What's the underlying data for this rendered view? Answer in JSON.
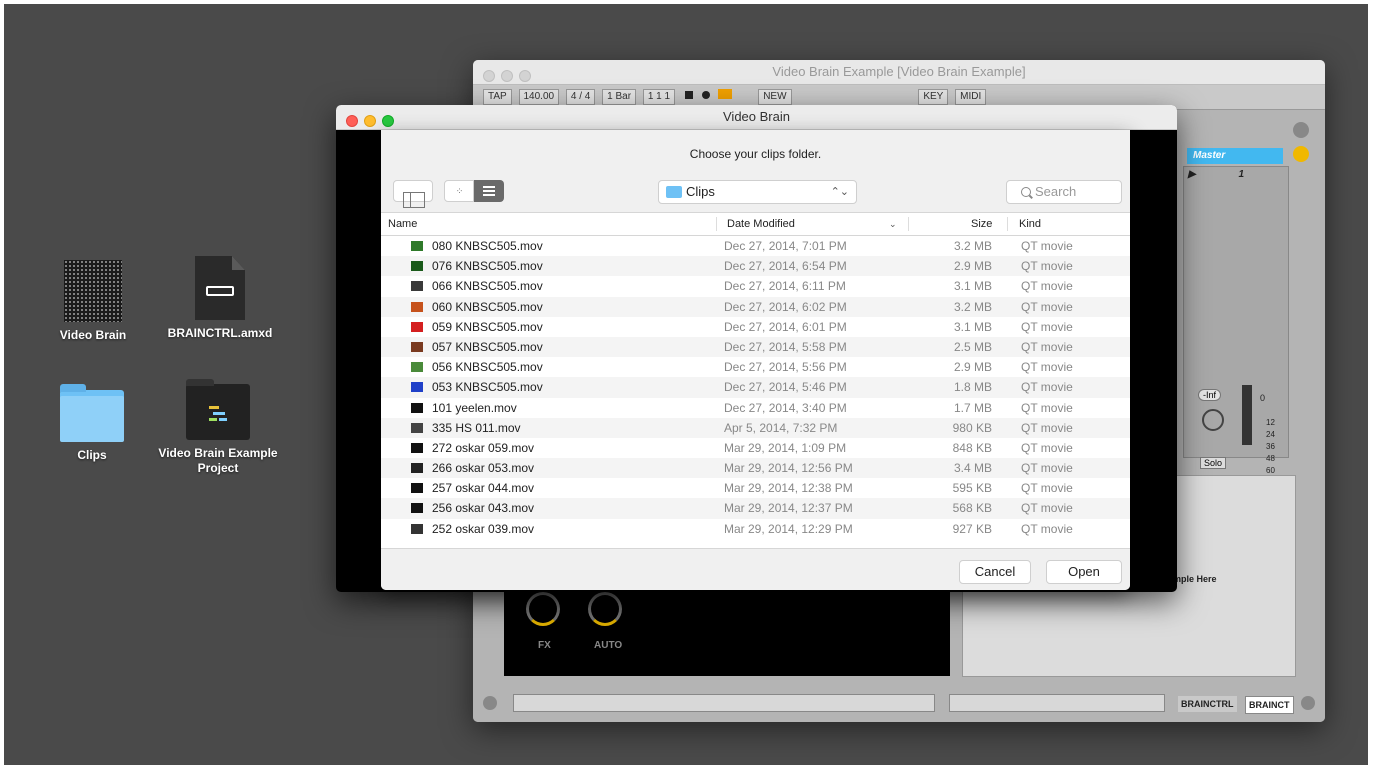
{
  "desktop": {
    "icons": [
      {
        "label": "Video Brain"
      },
      {
        "label": "BRAINCTRL.amxd"
      },
      {
        "label": "Clips"
      },
      {
        "label": "Video Brain Example Project"
      }
    ]
  },
  "live_window": {
    "title": "Video Brain Example  [Video Brain Example]",
    "control_bar": {
      "tap": "TAP",
      "tempo": "140.00",
      "signature": "4 / 4",
      "quantize": "1 Bar",
      "position": "1    1    1",
      "new_label": "NEW",
      "key_label": "KEY",
      "midi_label": "MIDI"
    },
    "master_label": "Master",
    "master_clip": "1",
    "volume_readout": "-Inf",
    "volume_value": "0",
    "meter_scale": [
      "12",
      "24",
      "36",
      "48",
      "60"
    ],
    "solo_label": "Solo",
    "knob_labels": [
      "FX",
      "AUTO"
    ],
    "drop_hint": "mple Here",
    "device_tabs": [
      "BRAINCTRL",
      "BRAINCT"
    ]
  },
  "videobrain_window": {
    "title": "Video Brain"
  },
  "dialog": {
    "prompt": "Choose your clips folder.",
    "location": "Clips",
    "search_placeholder": "Search",
    "columns": {
      "name": "Name",
      "date": "Date Modified",
      "size": "Size",
      "kind": "Kind"
    },
    "files": [
      {
        "name": "080 KNBSC505.mov",
        "date": "Dec 27, 2014, 7:01 PM",
        "size": "3.2 MB",
        "kind": "QT movie",
        "thumb": "#2f7a2a"
      },
      {
        "name": "076 KNBSC505.mov",
        "date": "Dec 27, 2014, 6:54 PM",
        "size": "2.9 MB",
        "kind": "QT movie",
        "thumb": "#1a5a1a"
      },
      {
        "name": "066 KNBSC505.mov",
        "date": "Dec 27, 2014, 6:11 PM",
        "size": "3.1 MB",
        "kind": "QT movie",
        "thumb": "#3a3a3a"
      },
      {
        "name": "060 KNBSC505.mov",
        "date": "Dec 27, 2014, 6:02 PM",
        "size": "3.2 MB",
        "kind": "QT movie",
        "thumb": "#c6521c"
      },
      {
        "name": "059 KNBSC505.mov",
        "date": "Dec 27, 2014, 6:01 PM",
        "size": "3.1 MB",
        "kind": "QT movie",
        "thumb": "#d42020"
      },
      {
        "name": "057 KNBSC505.mov",
        "date": "Dec 27, 2014, 5:58 PM",
        "size": "2.5 MB",
        "kind": "QT movie",
        "thumb": "#7a3a20"
      },
      {
        "name": "056 KNBSC505.mov",
        "date": "Dec 27, 2014, 5:56 PM",
        "size": "2.9 MB",
        "kind": "QT movie",
        "thumb": "#4a8a3a"
      },
      {
        "name": "053 KNBSC505.mov",
        "date": "Dec 27, 2014, 5:46 PM",
        "size": "1.8 MB",
        "kind": "QT movie",
        "thumb": "#2040c8"
      },
      {
        "name": "101 yeelen.mov",
        "date": "Dec 27, 2014, 3:40 PM",
        "size": "1.7 MB",
        "kind": "QT movie",
        "thumb": "#111111"
      },
      {
        "name": "335 HS 011.mov",
        "date": "Apr 5, 2014, 7:32 PM",
        "size": "980 KB",
        "kind": "QT movie",
        "thumb": "#444444"
      },
      {
        "name": "272 oskar 059.mov",
        "date": "Mar 29, 2014, 1:09 PM",
        "size": "848 KB",
        "kind": "QT movie",
        "thumb": "#111111"
      },
      {
        "name": "266 oskar 053.mov",
        "date": "Mar 29, 2014, 12:56 PM",
        "size": "3.4 MB",
        "kind": "QT movie",
        "thumb": "#222222"
      },
      {
        "name": "257 oskar 044.mov",
        "date": "Mar 29, 2014, 12:38 PM",
        "size": "595 KB",
        "kind": "QT movie",
        "thumb": "#111111"
      },
      {
        "name": "256 oskar 043.mov",
        "date": "Mar 29, 2014, 12:37 PM",
        "size": "568 KB",
        "kind": "QT movie",
        "thumb": "#111111"
      },
      {
        "name": "252 oskar 039.mov",
        "date": "Mar 29, 2014, 12:29 PM",
        "size": "927 KB",
        "kind": "QT movie",
        "thumb": "#333333"
      }
    ],
    "cancel_label": "Cancel",
    "open_label": "Open"
  }
}
